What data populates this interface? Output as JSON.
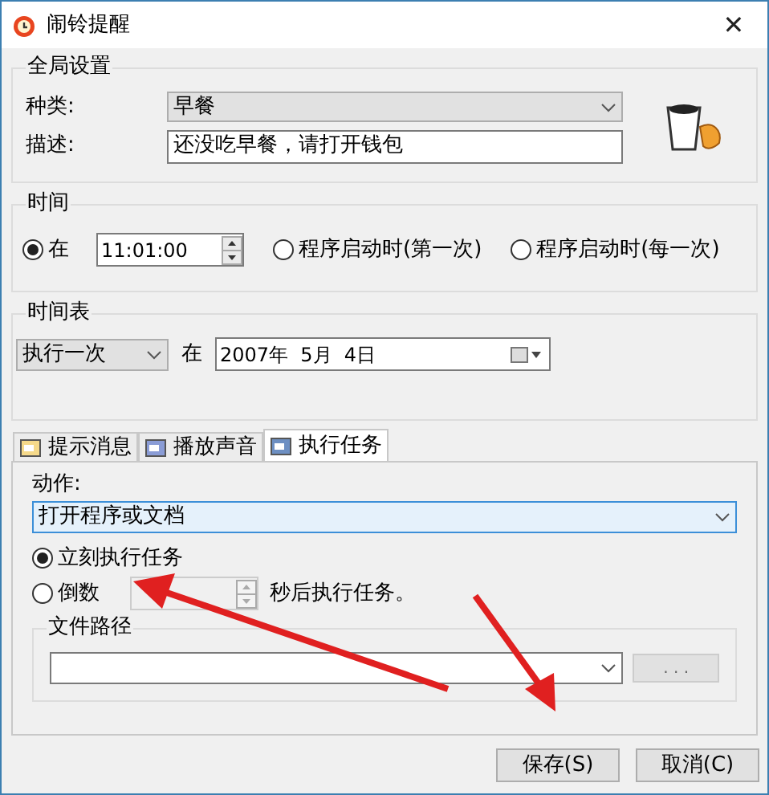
{
  "window": {
    "title": "闹铃提醒",
    "close": "✕"
  },
  "global": {
    "label": "全局设置",
    "fields": [
      {
        "label": "种类:",
        "kind": "select",
        "value": "早餐"
      },
      {
        "label": "描述:",
        "kind": "text",
        "value": "还没吃早餐，请打开钱包"
      }
    ]
  },
  "time": {
    "label": "时间",
    "options": [
      {
        "label": "在",
        "kind": "time",
        "value": "11:01:00",
        "selected": true
      },
      {
        "label": "程序启动时(第一次)",
        "kind": "plain",
        "selected": false
      },
      {
        "label": "程序启动时(每一次)",
        "kind": "plain",
        "selected": false
      }
    ]
  },
  "schedule": {
    "label": "时间表",
    "repeat": "执行一次",
    "at": "在",
    "date": "2007年  5月  4日"
  },
  "tabs": [
    {
      "label": "提示消息",
      "selected": false
    },
    {
      "label": "播放声音",
      "selected": false
    },
    {
      "label": "执行任务",
      "selected": true
    }
  ],
  "task": {
    "action_label": "动作:",
    "action": "打开程序或文档",
    "options": [
      {
        "label": "立刻执行任务",
        "kind": "plain",
        "selected": true
      },
      {
        "label": "倒数",
        "kind": "countdown",
        "suffix": "秒后执行任务。",
        "selected": false
      }
    ],
    "file_path": {
      "label": "文件路径",
      "browse": ". . ."
    }
  },
  "buttons": [
    {
      "label": "保存(S)"
    },
    {
      "label": "取消(C)"
    }
  ]
}
